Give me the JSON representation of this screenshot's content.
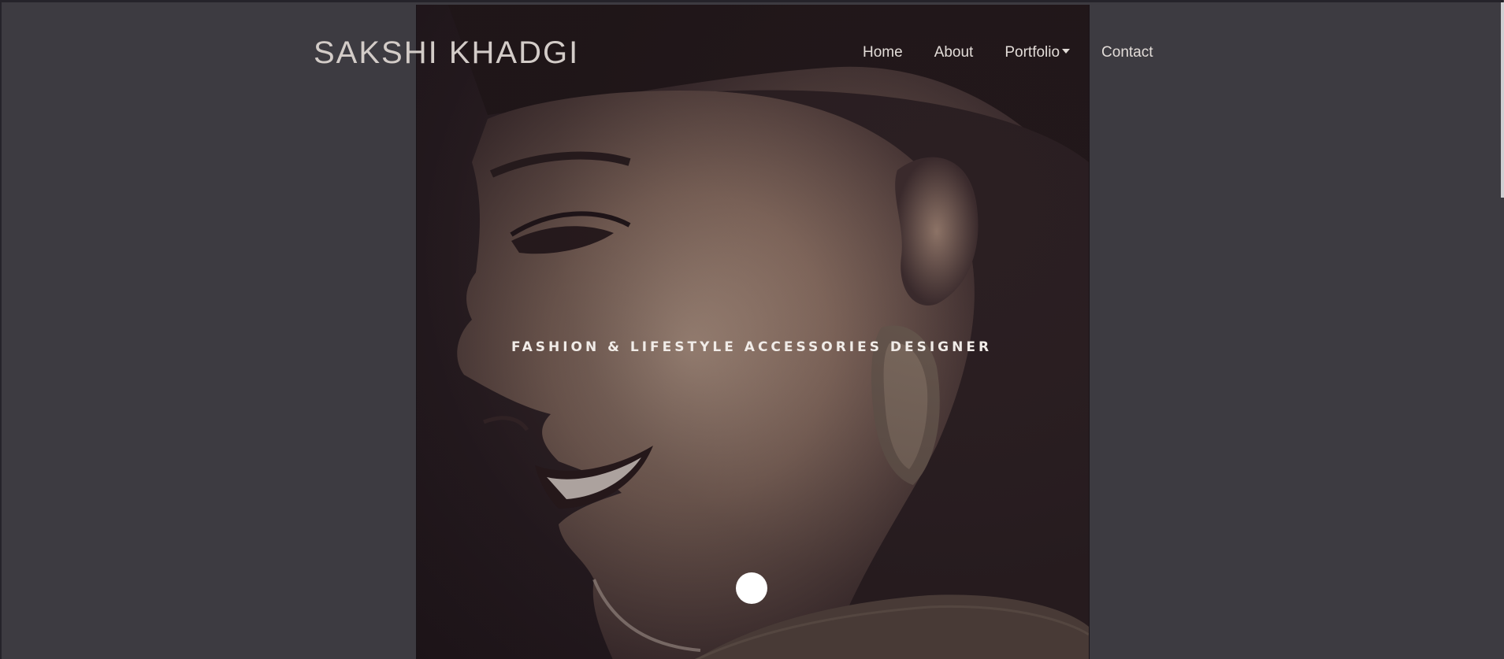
{
  "site": {
    "brand": "SAKSHI KHADGI"
  },
  "nav": {
    "items": [
      {
        "label": "Home"
      },
      {
        "label": "About"
      },
      {
        "label": "Portfolio"
      },
      {
        "label": "Contact"
      }
    ]
  },
  "hero": {
    "tagline": "FASHION & LIFESTYLE ACCESSORIES DESIGNER"
  },
  "colors": {
    "page_bg": "#3d3b41",
    "hero_dark": "#1d1418",
    "text_light": "#e2dcd8",
    "dot": "#ffffff"
  },
  "icons": {
    "portfolio_dropdown": "caret-down-icon",
    "scroll_indicator": "scroll-dot-icon"
  }
}
